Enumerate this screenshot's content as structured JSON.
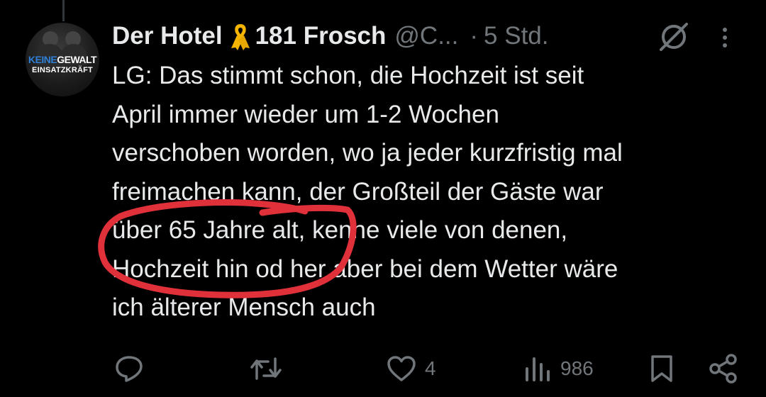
{
  "post": {
    "display_name": "Der Hotel",
    "display_name_suffix": "181 Frosch",
    "handle": "@C...",
    "separator": "·",
    "time": "5 Std.",
    "avatar_banner": {
      "word1": "KEINE",
      "word2": "GEWALT",
      "line2": "EINSATZKRÄFT"
    },
    "text_lines": [
      "LG: Das stimmt schon, die Hochzeit ist seit",
      "April immer wieder um 1-2 Wochen",
      "verschoben worden, wo ja jeder kurzfristig mal",
      "freimachen kann, der Großteil der Gäste war",
      "über 65 Jahre alt, kenne viele von denen,",
      "Hochzeit hin od her aber bei dem Wetter wäre",
      "ich älterer Mensch auch"
    ]
  },
  "actions": {
    "reply_count": "",
    "repost_count": "",
    "like_count": "4",
    "views_count": "986"
  },
  "icons": [
    "grok-icon",
    "more-icon",
    "reply-icon",
    "repost-icon",
    "like-icon",
    "views-icon",
    "bookmark-icon",
    "share-icon"
  ],
  "colors": {
    "background": "#000000",
    "text": "#e7e9ea",
    "secondary": "#71767b",
    "ribbon": "#f5b400",
    "annotation": "#e0303a"
  }
}
